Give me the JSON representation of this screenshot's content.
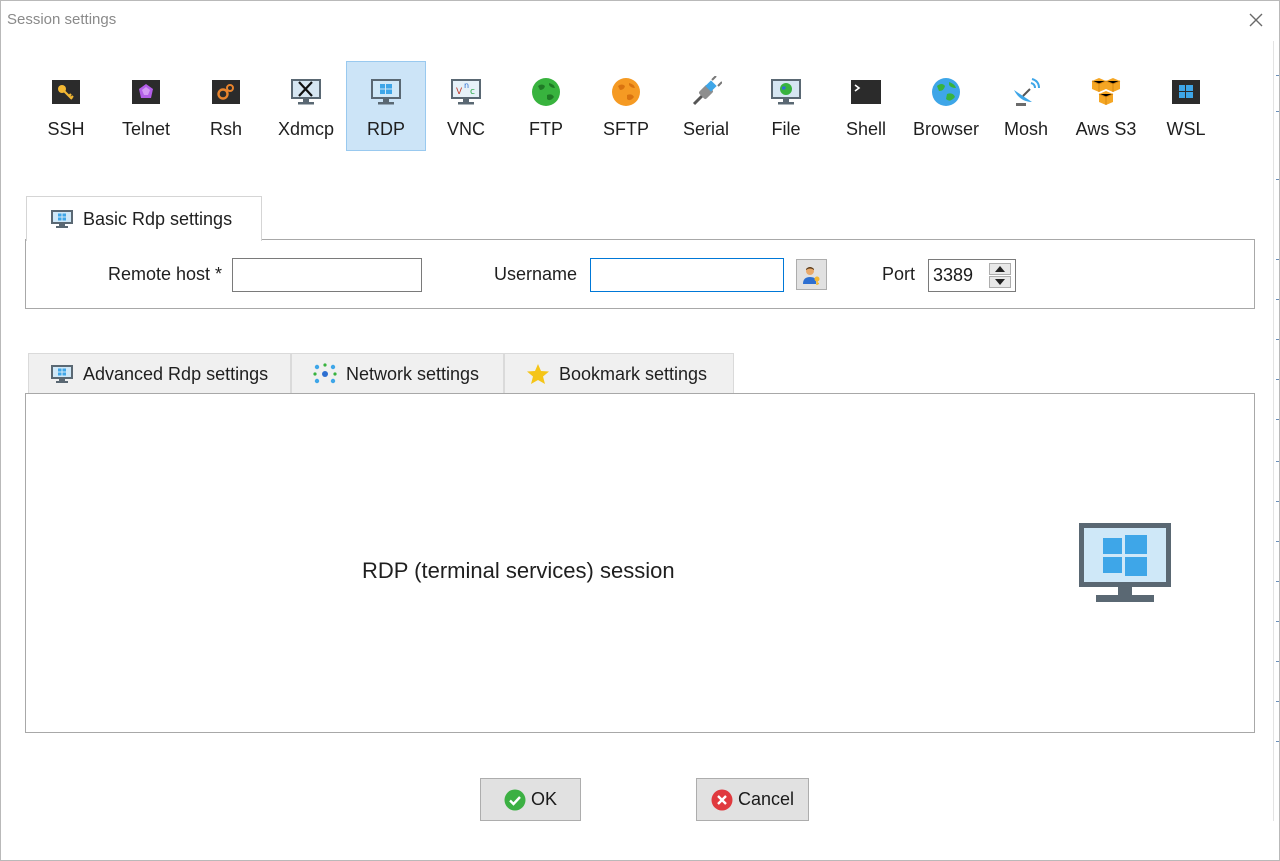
{
  "window": {
    "title": "Session settings"
  },
  "session_types": [
    {
      "id": "ssh",
      "label": "SSH",
      "icon": "ssh-key-icon"
    },
    {
      "id": "telnet",
      "label": "Telnet",
      "icon": "telnet-icon"
    },
    {
      "id": "rsh",
      "label": "Rsh",
      "icon": "rsh-gears-icon"
    },
    {
      "id": "xdmcp",
      "label": "Xdmcp",
      "icon": "xdmcp-monitor-icon"
    },
    {
      "id": "rdp",
      "label": "RDP",
      "icon": "rdp-monitor-icon",
      "selected": true
    },
    {
      "id": "vnc",
      "label": "VNC",
      "icon": "vnc-monitor-icon"
    },
    {
      "id": "ftp",
      "label": "FTP",
      "icon": "ftp-globe-icon"
    },
    {
      "id": "sftp",
      "label": "SFTP",
      "icon": "sftp-globe-icon"
    },
    {
      "id": "serial",
      "label": "Serial",
      "icon": "serial-plug-icon"
    },
    {
      "id": "file",
      "label": "File",
      "icon": "file-monitor-icon"
    },
    {
      "id": "shell",
      "label": "Shell",
      "icon": "shell-terminal-icon"
    },
    {
      "id": "browser",
      "label": "Browser",
      "icon": "browser-globe-icon"
    },
    {
      "id": "mosh",
      "label": "Mosh",
      "icon": "mosh-satellite-icon"
    },
    {
      "id": "awss3",
      "label": "Aws S3",
      "icon": "aws-s3-cubes-icon"
    },
    {
      "id": "wsl",
      "label": "WSL",
      "icon": "wsl-windows-icon"
    }
  ],
  "basic": {
    "tab_label": "Basic Rdp settings",
    "remote_host_label": "Remote host *",
    "remote_host_value": "",
    "username_label": "Username",
    "username_value": "",
    "port_label": "Port",
    "port_value": "3389"
  },
  "advanced_tabs": [
    {
      "label": "Advanced Rdp settings",
      "icon": "monitor-icon"
    },
    {
      "label": "Network settings",
      "icon": "network-icon"
    },
    {
      "label": "Bookmark settings",
      "icon": "star-icon"
    }
  ],
  "panel": {
    "description": "RDP (terminal services) session"
  },
  "buttons": {
    "ok": "OK",
    "cancel": "Cancel"
  },
  "colors": {
    "selection_bg": "#cce4f7",
    "focus_border": "#0078d7",
    "ok_green": "#3cb043",
    "cancel_red": "#e0393e",
    "rdp_blue": "#3ea6e8"
  }
}
